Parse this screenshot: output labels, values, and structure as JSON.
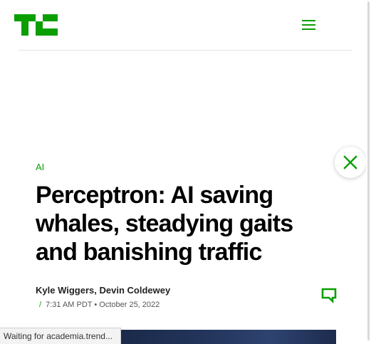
{
  "header": {
    "logo_alt": "TC",
    "menu_icon": "hamburger-menu-icon",
    "brand_color": "#0a9e01"
  },
  "article": {
    "category": "AI",
    "title": "Perceptron: AI saving whales, steadying gaits and banishing traffic",
    "authors": [
      {
        "name": "Kyle Wiggers"
      },
      {
        "name": "Devin Coldewey"
      }
    ],
    "author_separator": ", ",
    "time": "7:31 AM PDT",
    "bullet": "•",
    "date": "October 25, 2022",
    "comment_icon": "comment-icon"
  },
  "overlay": {
    "close_icon": "close-icon"
  },
  "browser": {
    "status_text": "Waiting for academia.trend..."
  }
}
